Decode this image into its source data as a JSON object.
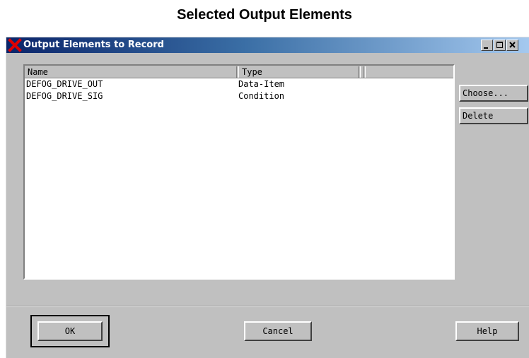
{
  "caption": "Selected Output Elements",
  "window": {
    "title": "Output Elements to Record",
    "icons": {
      "app": "x-logo-icon",
      "minimize": "minimize-icon",
      "maximize": "maximize-icon",
      "close": "close-icon"
    },
    "colors": {
      "title_start": "#0a246a",
      "title_end": "#a6caf0",
      "face": "#c0c0c0",
      "app_icon": "#e00000"
    }
  },
  "list": {
    "columns": [
      "Name",
      "Type"
    ],
    "rows": [
      {
        "name": "DEFOG_DRIVE_OUT",
        "type": "Data-Item"
      },
      {
        "name": "DEFOG_DRIVE_SIG",
        "type": "Condition"
      }
    ]
  },
  "side_buttons": {
    "choose": "Choose...",
    "delete": "Delete"
  },
  "footer": {
    "ok": "OK",
    "cancel": "Cancel",
    "help": "Help"
  }
}
